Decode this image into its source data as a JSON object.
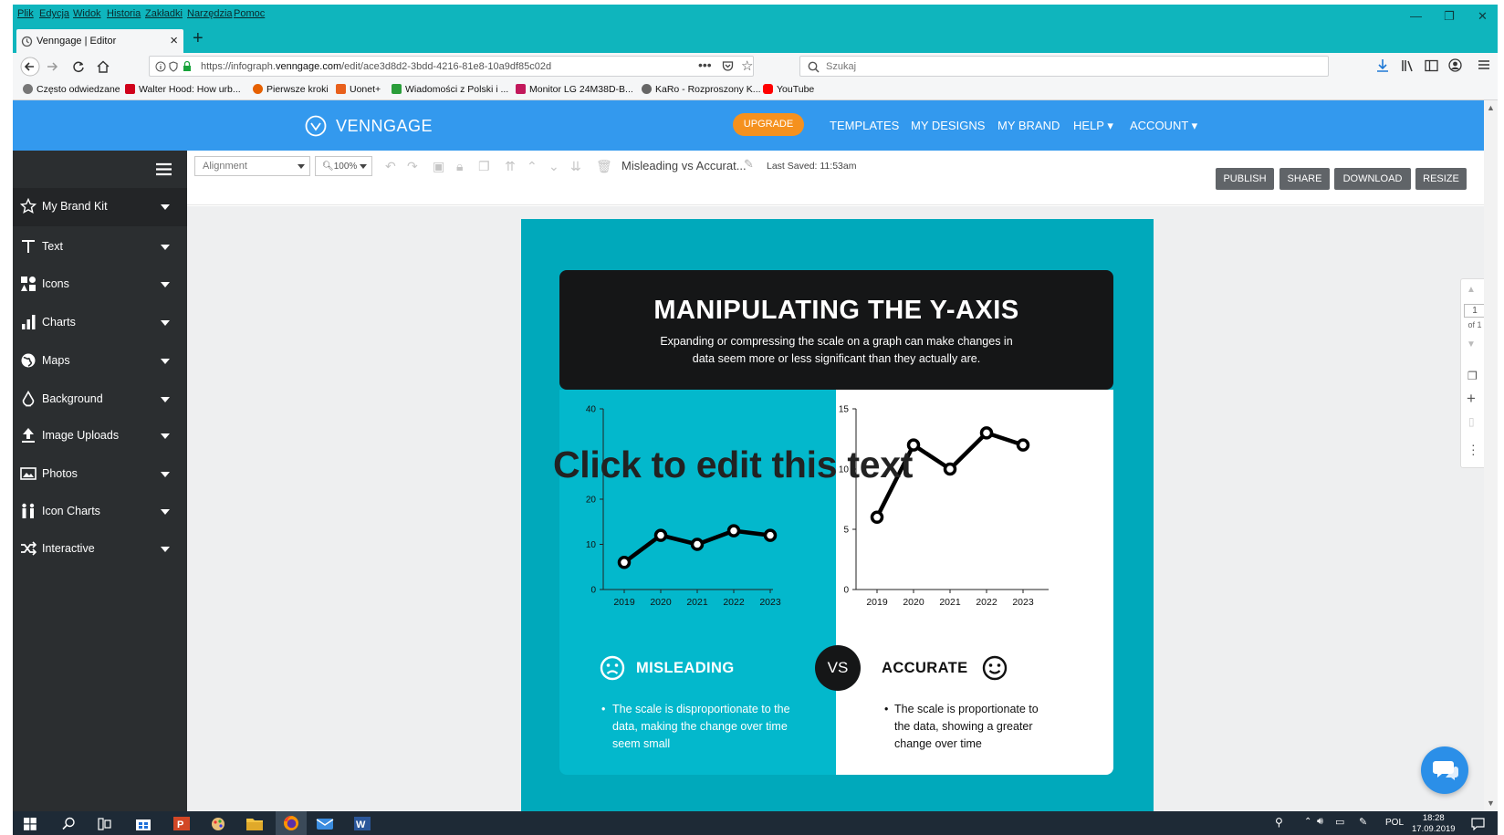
{
  "browser": {
    "menu": [
      "Plik",
      "Edycja",
      "Widok",
      "Historia",
      "Zakładki",
      "Narzędzia",
      "Pomoc"
    ],
    "tab_title": "Venngage | Editor",
    "url_prefix": "https://infograph.",
    "url_domain": "venngage.com",
    "url_path": "/edit/ace3d8d2-3bdd-4216-81e8-10a9df85c02d",
    "search_placeholder": "Szukaj",
    "bookmarks": [
      {
        "label": "Często odwiedzane",
        "color": "#555555"
      },
      {
        "label": "Walter Hood: How urb...",
        "color": "#d0021b"
      },
      {
        "label": "Pierwsze kroki",
        "color": "#e66000"
      },
      {
        "label": "Uonet+",
        "color": "#e8601c"
      },
      {
        "label": "Wiadomości z Polski i ...",
        "color": "#2a9d3a"
      },
      {
        "label": "Monitor LG 24M38D-B...",
        "color": "#c2185b"
      },
      {
        "label": "KaRo - Rozproszony K...",
        "color": "#666666"
      },
      {
        "label": "YouTube",
        "color": "#ff0000"
      }
    ]
  },
  "app": {
    "logo": "VENNGAGE",
    "upgrade": "UPGRADE",
    "nav": [
      "TEMPLATES",
      "MY DESIGNS",
      "MY BRAND",
      "HELP ▾",
      "ACCOUNT ▾"
    ]
  },
  "sidebar": {
    "items": [
      {
        "label": "My Brand Kit",
        "icon": "star-icon"
      },
      {
        "label": "Text",
        "icon": "text-icon"
      },
      {
        "label": "Icons",
        "icon": "icons-grid-icon"
      },
      {
        "label": "Charts",
        "icon": "bar-chart-icon"
      },
      {
        "label": "Maps",
        "icon": "globe-icon"
      },
      {
        "label": "Background",
        "icon": "paint-bucket-icon"
      },
      {
        "label": "Image Uploads",
        "icon": "upload-icon"
      },
      {
        "label": "Photos",
        "icon": "photo-icon"
      },
      {
        "label": "Icon Charts",
        "icon": "people-chart-icon"
      },
      {
        "label": "Interactive",
        "icon": "shuffle-icon"
      }
    ]
  },
  "toolbar": {
    "alignment": "Alignment",
    "zoom": "100%",
    "doc_name": "Misleading vs Accurat...",
    "last_saved": "Last Saved: 11:53am",
    "buttons": [
      "PUBLISH",
      "SHARE",
      "DOWNLOAD",
      "RESIZE"
    ]
  },
  "design": {
    "title": "MANIPULATING THE Y-AXIS",
    "subtitle": "Expanding or compressing the scale on a graph can make changes in data seem more or less significant than they actually are.",
    "vs": "VS",
    "left_heading": "MISLEADING",
    "left_bullet": "The scale is disproportionate to the data, making the change over time seem small",
    "right_heading": "ACCURATE",
    "right_bullet": "The scale is proportionate to the data, showing a greater change over time",
    "edit_overlay": "Click to edit this text"
  },
  "chart_data": [
    {
      "type": "line",
      "categories": [
        "2019",
        "2020",
        "2021",
        "2022",
        "2023"
      ],
      "values": [
        6,
        12,
        10,
        13,
        12
      ],
      "ylim": [
        0,
        40
      ],
      "yticks": [
        "0",
        "10",
        "20",
        "40"
      ],
      "color": "#000000"
    },
    {
      "type": "line",
      "categories": [
        "2019",
        "2020",
        "2021",
        "2022",
        "2023"
      ],
      "values": [
        6,
        12,
        10,
        13,
        12
      ],
      "ylim": [
        0,
        15
      ],
      "yticks": [
        "0",
        "5",
        "10",
        "15"
      ],
      "color": "#000000"
    }
  ],
  "page_indicator": {
    "num": "1",
    "of": "of 1"
  },
  "taskbar": {
    "lang": "POL",
    "time": "18:28",
    "date": "17.09.2019"
  },
  "colors": {
    "teal": "#0fb5bd",
    "header_blue": "#3399ee",
    "upgrade": "#f5911e",
    "sidebar": "#2b2e30"
  }
}
